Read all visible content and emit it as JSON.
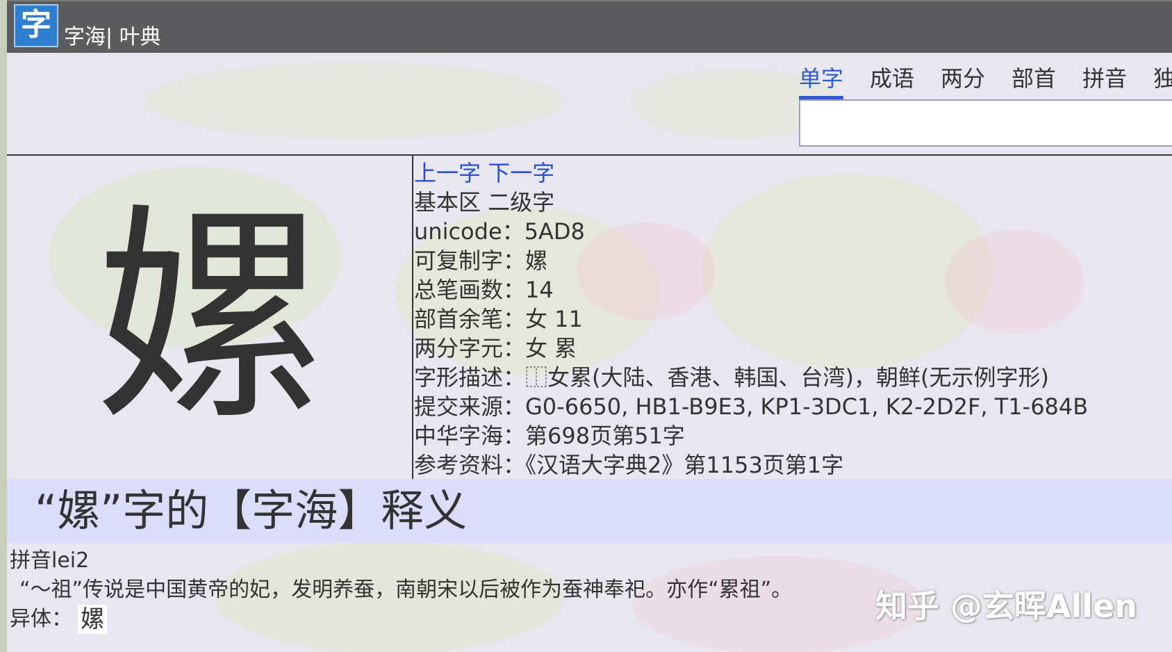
{
  "header": {
    "logo_glyph": "字",
    "site_title": "字海| 叶典"
  },
  "tabs": [
    {
      "label": "单字",
      "active": true
    },
    {
      "label": "成语",
      "active": false
    },
    {
      "label": "两分",
      "active": false
    },
    {
      "label": "部首",
      "active": false
    },
    {
      "label": "拼音",
      "active": false
    },
    {
      "label": "独",
      "active": false
    }
  ],
  "search": {
    "value": ""
  },
  "character": {
    "glyph": "嫘",
    "nav": {
      "prev": "上一字",
      "next": "下一字"
    },
    "info": [
      "基本区 二级字",
      "unicode：5AD8",
      "可复制字：嫘",
      "总笔画数：14",
      "部首余笔：女 11",
      "两分字元：女 累",
      "字形描述：⿰女累(大陆、香港、韩国、台湾)，朝鲜(无示例字形)",
      "提交来源：G0-6650, HB1-B9E3, KP1-3DC1, K2-2D2F, T1-684B",
      "中华字海：第698页第51字",
      "参考资料：《汉语大字典2》第1153页第1字"
    ]
  },
  "definition": {
    "title": "“嫘”字的【字海】释义",
    "pinyin": "拼音lei2",
    "text": "“～祖”传说是中国黄帝的妃，发明养蚕，南朝宋以后被作为蚕神奉祀。亦作“累祖”。",
    "variant_label": "异体：",
    "variant_char": "嫘"
  },
  "watermark": "知乎 @玄晖Allen",
  "colors": {
    "header_bg": "#5c5c5e",
    "accent": "#2f5bd0",
    "banner_bg": "#dcdcfb"
  }
}
